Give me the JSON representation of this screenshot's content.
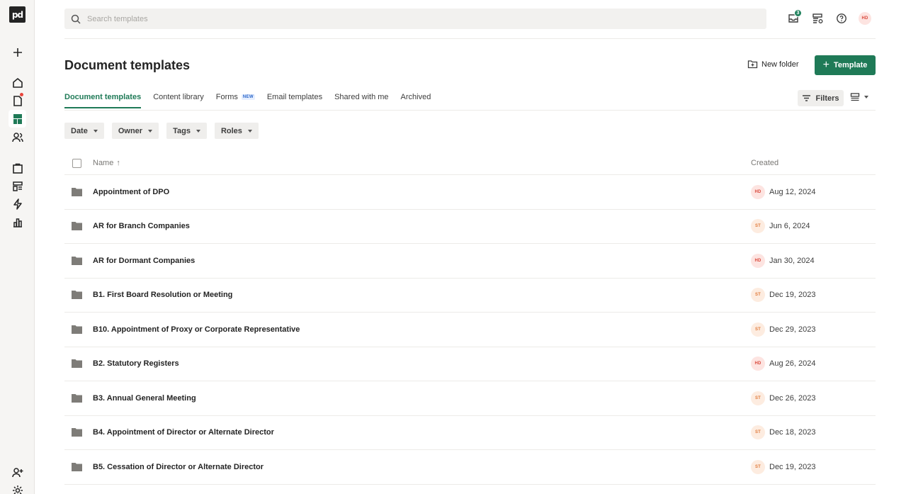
{
  "sidebar": {
    "logo": "pd",
    "items": [
      {
        "icon": "plus-icon"
      },
      {
        "icon": "home-icon"
      },
      {
        "icon": "documents-icon",
        "has_dot": true
      },
      {
        "icon": "templates-icon",
        "active": true
      },
      {
        "icon": "contacts-icon"
      },
      {
        "icon": "catalog-icon"
      },
      {
        "icon": "forms-icon"
      },
      {
        "icon": "automation-icon"
      },
      {
        "icon": "reports-icon"
      },
      {
        "icon": "add-user-icon"
      },
      {
        "icon": "settings-icon"
      }
    ]
  },
  "search": {
    "placeholder": "Search templates"
  },
  "topbar": {
    "notification_count": "3",
    "user_initials": "HD"
  },
  "header": {
    "title": "Document templates",
    "new_folder_label": "New folder",
    "template_button_label": "Template"
  },
  "tabs": [
    {
      "label": "Document templates",
      "active": true
    },
    {
      "label": "Content library"
    },
    {
      "label": "Forms",
      "tag": "NEW"
    },
    {
      "label": "Email templates"
    },
    {
      "label": "Shared with me"
    },
    {
      "label": "Archived"
    }
  ],
  "filters_label": "Filters",
  "chips": [
    {
      "label": "Date"
    },
    {
      "label": "Owner"
    },
    {
      "label": "Tags"
    },
    {
      "label": "Roles"
    }
  ],
  "table": {
    "columns": {
      "name": "Name",
      "created": "Created"
    },
    "sort_indicator": "↑",
    "rows": [
      {
        "name": "Appointment of DPO",
        "owner": "HD",
        "created": "Aug 12, 2024"
      },
      {
        "name": "AR for Branch Companies",
        "owner": "ST",
        "created": "Jun 6, 2024"
      },
      {
        "name": "AR for Dormant Companies",
        "owner": "HD",
        "created": "Jan 30, 2024"
      },
      {
        "name": "B1. First Board Resolution or Meeting",
        "owner": "ST",
        "created": "Dec 19, 2023"
      },
      {
        "name": "B10. Appointment of Proxy or Corporate Representative",
        "owner": "ST",
        "created": "Dec 29, 2023"
      },
      {
        "name": "B2. Statutory Registers",
        "owner": "HD",
        "created": "Aug 26, 2024"
      },
      {
        "name": "B3. Annual General Meeting",
        "owner": "ST",
        "created": "Dec 26, 2023"
      },
      {
        "name": "B4. Appointment of Director or Alternate Director",
        "owner": "ST",
        "created": "Dec 18, 2023"
      },
      {
        "name": "B5. Cessation of Director or Alternate Director",
        "owner": "ST",
        "created": "Dec 19, 2023"
      }
    ]
  },
  "colors": {
    "accent": "#1f7a57",
    "hd_avatar": "#fde4e1",
    "st_avatar": "#fdece0"
  }
}
